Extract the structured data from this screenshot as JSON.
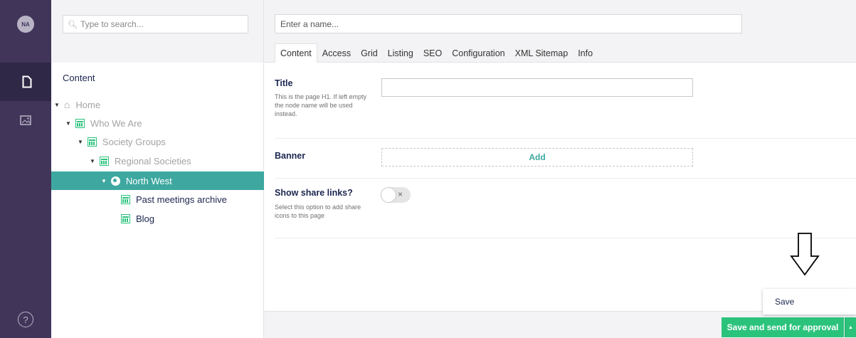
{
  "user": {
    "initials": "NA"
  },
  "rail": {
    "items": [
      {
        "icon": "document-icon",
        "active": true
      },
      {
        "icon": "image-icon",
        "active": false
      }
    ],
    "help_icon": "?"
  },
  "tree": {
    "search_placeholder": "Type to search...",
    "section_title": "Content",
    "nodes": [
      {
        "label": "Home",
        "icon": "home-icon",
        "expanded": true
      },
      {
        "label": "Who We Are",
        "icon": "document-icon",
        "expanded": true
      },
      {
        "label": "Society Groups",
        "icon": "document-icon",
        "expanded": true
      },
      {
        "label": "Regional Societies",
        "icon": "document-icon",
        "expanded": true
      },
      {
        "label": "North West",
        "icon": "globe-icon",
        "expanded": true,
        "selected": true
      },
      {
        "label": "Past meetings archive",
        "icon": "document-icon"
      },
      {
        "label": "Blog",
        "icon": "document-icon"
      }
    ]
  },
  "editor": {
    "name_placeholder": "Enter a name...",
    "tabs": [
      "Content",
      "Access",
      "Grid",
      "Listing",
      "SEO",
      "Configuration",
      "XML Sitemap",
      "Info"
    ],
    "active_tab": "Content",
    "properties": {
      "title": {
        "label": "Title",
        "description": "This is the page H1. If left empty the node name will be used instead."
      },
      "banner": {
        "label": "Banner",
        "add_label": "Add"
      },
      "share": {
        "label": "Show share links?",
        "description": "Select this option to add share icons to this page",
        "toggle_symbol": "×"
      }
    }
  },
  "footer": {
    "primary_button": "Save and send for approval",
    "dropdown_caret": "▲",
    "dropdown_items": [
      "Save"
    ]
  },
  "colors": {
    "rail": "#413659",
    "accent": "#3ea8a0",
    "green": "#2bc37c"
  }
}
